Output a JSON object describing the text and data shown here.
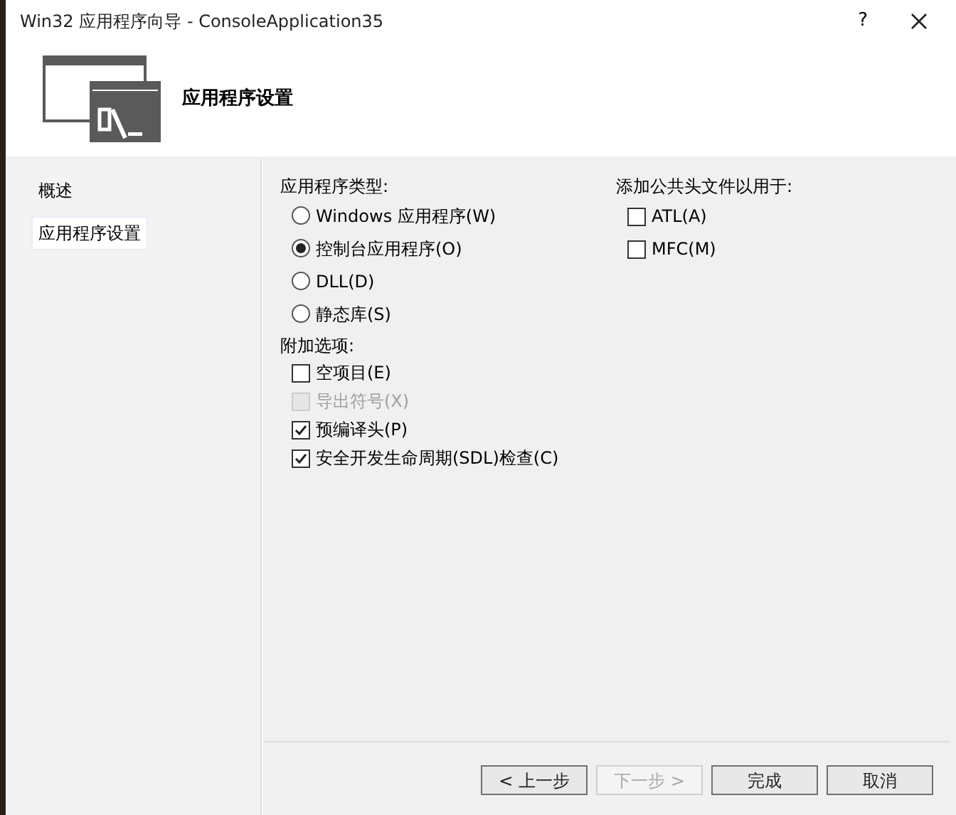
{
  "window": {
    "title": "Win32 应用程序向导 - ConsoleApplication35",
    "help": "?"
  },
  "header": {
    "title": "应用程序设置"
  },
  "sidebar": {
    "items": [
      {
        "label": "概述",
        "selected": false
      },
      {
        "label": "应用程序设置",
        "selected": true
      }
    ]
  },
  "app_type": {
    "label": "应用程序类型:",
    "options": [
      {
        "label": "Windows 应用程序(W)",
        "selected": false
      },
      {
        "label": "控制台应用程序(O)",
        "selected": true
      },
      {
        "label": "DLL(D)",
        "selected": false
      },
      {
        "label": "静态库(S)",
        "selected": false
      }
    ]
  },
  "extra_options": {
    "label": "附加选项:",
    "options": [
      {
        "label": "空项目(E)",
        "checked": false,
        "disabled": false
      },
      {
        "label": "导出符号(X)",
        "checked": false,
        "disabled": true
      },
      {
        "label": "预编译头(P)",
        "checked": true,
        "disabled": false
      },
      {
        "label": "安全开发生命周期(SDL)检查(C)",
        "checked": true,
        "disabled": false
      }
    ]
  },
  "common_headers": {
    "label": "添加公共头文件以用于:",
    "options": [
      {
        "label": "ATL(A)",
        "checked": false,
        "disabled": false
      },
      {
        "label": "MFC(M)",
        "checked": false,
        "disabled": false
      }
    ]
  },
  "buttons": [
    {
      "label": "< 上一步",
      "disabled": false
    },
    {
      "label": "下一步 >",
      "disabled": true
    },
    {
      "label": "完成",
      "disabled": false
    },
    {
      "label": "取消",
      "disabled": false
    }
  ]
}
